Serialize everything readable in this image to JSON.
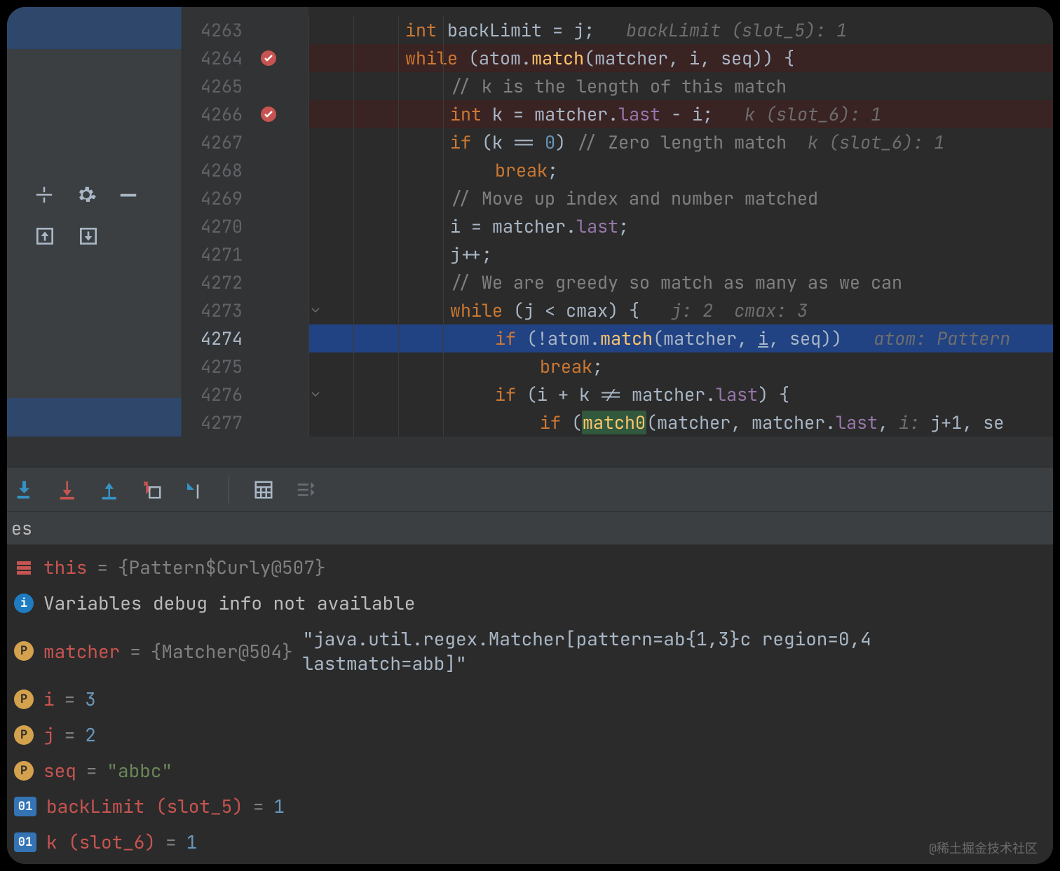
{
  "gutter": {
    "lines": [
      "4263",
      "4264",
      "4265",
      "4266",
      "4267",
      "4268",
      "4269",
      "4270",
      "4271",
      "4272",
      "4273",
      "4274",
      "4275",
      "4276",
      "4277"
    ],
    "breakpoints": [
      1,
      3
    ],
    "current_line_index": 11,
    "folds": [
      1,
      10,
      13
    ]
  },
  "code": [
    {
      "indent": 6,
      "toks": [
        [
          "typ",
          "int"
        ],
        [
          "pun",
          " "
        ],
        [
          "id",
          "backLimit"
        ],
        [
          "pun",
          " = "
        ],
        [
          "id",
          "j"
        ],
        [
          "pun",
          ";   "
        ],
        [
          "hint",
          "backLimit (slot_5): 1"
        ]
      ]
    },
    {
      "indent": 6,
      "bp": true,
      "toks": [
        [
          "kw",
          "while"
        ],
        [
          "pun",
          " ("
        ],
        [
          "id",
          "atom"
        ],
        [
          "pun",
          "."
        ],
        [
          "mtd",
          "match"
        ],
        [
          "pun",
          "("
        ],
        [
          "id",
          "matcher"
        ],
        [
          "pun",
          ", "
        ],
        [
          "id",
          "i"
        ],
        [
          "pun",
          ", "
        ],
        [
          "id",
          "seq"
        ],
        [
          "pun",
          ")) {"
        ]
      ]
    },
    {
      "indent": 7,
      "toks": [
        [
          "cmt",
          "// k is the length of this match"
        ]
      ]
    },
    {
      "indent": 7,
      "bp": true,
      "toks": [
        [
          "typ",
          "int"
        ],
        [
          "pun",
          " "
        ],
        [
          "id",
          "k"
        ],
        [
          "pun",
          " = "
        ],
        [
          "id",
          "matcher"
        ],
        [
          "pun",
          "."
        ],
        [
          "fld",
          "last"
        ],
        [
          "pun",
          " - "
        ],
        [
          "id",
          "i"
        ],
        [
          "pun",
          ";   "
        ],
        [
          "hint",
          "k (slot_6): 1"
        ]
      ]
    },
    {
      "indent": 7,
      "toks": [
        [
          "kw",
          "if"
        ],
        [
          "pun",
          " ("
        ],
        [
          "id",
          "k"
        ],
        [
          "pun",
          " == "
        ],
        [
          "num",
          "0"
        ],
        [
          "pun",
          ") "
        ],
        [
          "cmt",
          "// Zero length match  "
        ],
        [
          "hint",
          "k (slot_6): 1"
        ]
      ]
    },
    {
      "indent": 8,
      "toks": [
        [
          "kw",
          "break"
        ],
        [
          "pun",
          ";"
        ]
      ]
    },
    {
      "indent": 7,
      "toks": [
        [
          "cmt",
          "// Move up index and number matched"
        ]
      ]
    },
    {
      "indent": 7,
      "toks": [
        [
          "id",
          "i"
        ],
        [
          "pun",
          " = "
        ],
        [
          "id",
          "matcher"
        ],
        [
          "pun",
          "."
        ],
        [
          "fld",
          "last"
        ],
        [
          "pun",
          ";"
        ]
      ]
    },
    {
      "indent": 7,
      "toks": [
        [
          "id",
          "j"
        ],
        [
          "pun",
          "++;"
        ]
      ]
    },
    {
      "indent": 7,
      "toks": [
        [
          "cmt",
          "// We are greedy so match as many as we can"
        ]
      ]
    },
    {
      "indent": 7,
      "toks": [
        [
          "kw",
          "while"
        ],
        [
          "pun",
          " ("
        ],
        [
          "id",
          "j"
        ],
        [
          "pun",
          " < "
        ],
        [
          "id",
          "cmax"
        ],
        [
          "pun",
          ") {   "
        ],
        [
          "hint",
          "j: 2  cmax: 3"
        ]
      ]
    },
    {
      "indent": 8,
      "current": true,
      "toks": [
        [
          "kw",
          "if"
        ],
        [
          "pun",
          " (!"
        ],
        [
          "id",
          "atom"
        ],
        [
          "pun",
          "."
        ],
        [
          "mtd",
          "match"
        ],
        [
          "pun",
          "("
        ],
        [
          "id",
          "matcher"
        ],
        [
          "pun",
          ", "
        ],
        [
          "id",
          "i"
        ],
        [
          "pun",
          ", "
        ],
        [
          "id",
          "seq"
        ],
        [
          "pun",
          "))   "
        ],
        [
          "hint",
          "atom: Pattern"
        ]
      ],
      "underlines": [
        "i"
      ]
    },
    {
      "indent": 9,
      "toks": [
        [
          "kw",
          "break"
        ],
        [
          "pun",
          ";"
        ]
      ]
    },
    {
      "indent": 8,
      "toks": [
        [
          "kw",
          "if"
        ],
        [
          "pun",
          " ("
        ],
        [
          "id",
          "i"
        ],
        [
          "pun",
          " + "
        ],
        [
          "id",
          "k"
        ],
        [
          "pun",
          " != "
        ],
        [
          "id",
          "matcher"
        ],
        [
          "pun",
          "."
        ],
        [
          "fld",
          "last"
        ],
        [
          "pun",
          ") {"
        ]
      ]
    },
    {
      "indent": 9,
      "partial": true,
      "toks": [
        [
          "kw",
          "if"
        ],
        [
          "pun",
          " ("
        ],
        [
          "hl",
          "match0"
        ],
        [
          "pun",
          "("
        ],
        [
          "id",
          "matcher"
        ],
        [
          "pun",
          ", "
        ],
        [
          "id",
          "matcher"
        ],
        [
          "pun",
          "."
        ],
        [
          "fld",
          "last"
        ],
        [
          "pun",
          ", "
        ],
        [
          "hint",
          "i: "
        ],
        [
          "id",
          "j+1"
        ],
        [
          "pun",
          ", "
        ],
        [
          "id",
          "se"
        ]
      ]
    }
  ],
  "variables_tab": "es",
  "variables": [
    {
      "icon": "stack",
      "name": "this",
      "eq": " = ",
      "obj": "{Pattern$Curly@507}"
    },
    {
      "icon": "info",
      "text": "Variables debug info not available"
    },
    {
      "icon": "p",
      "name": "matcher",
      "eq": " = ",
      "obj": "{Matcher@504}",
      "val": " \"java.util.regex.Matcher[pattern=ab{1,3}c region=0,4 lastmatch=abb]\""
    },
    {
      "icon": "p",
      "name": "i",
      "eq": " = ",
      "int": "3"
    },
    {
      "icon": "p",
      "name": "j",
      "eq": " = ",
      "int": "2"
    },
    {
      "icon": "p",
      "name": "seq",
      "eq": " = ",
      "str": "\"abbc\""
    },
    {
      "icon": "slot",
      "slot": "01",
      "name": "backLimit (slot_5)",
      "eq": " = ",
      "int": "1"
    },
    {
      "icon": "slot",
      "slot": "01",
      "name": "k (slot_6)",
      "eq": " = ",
      "int": "1"
    }
  ],
  "watermark": "@稀土掘金技术社区"
}
